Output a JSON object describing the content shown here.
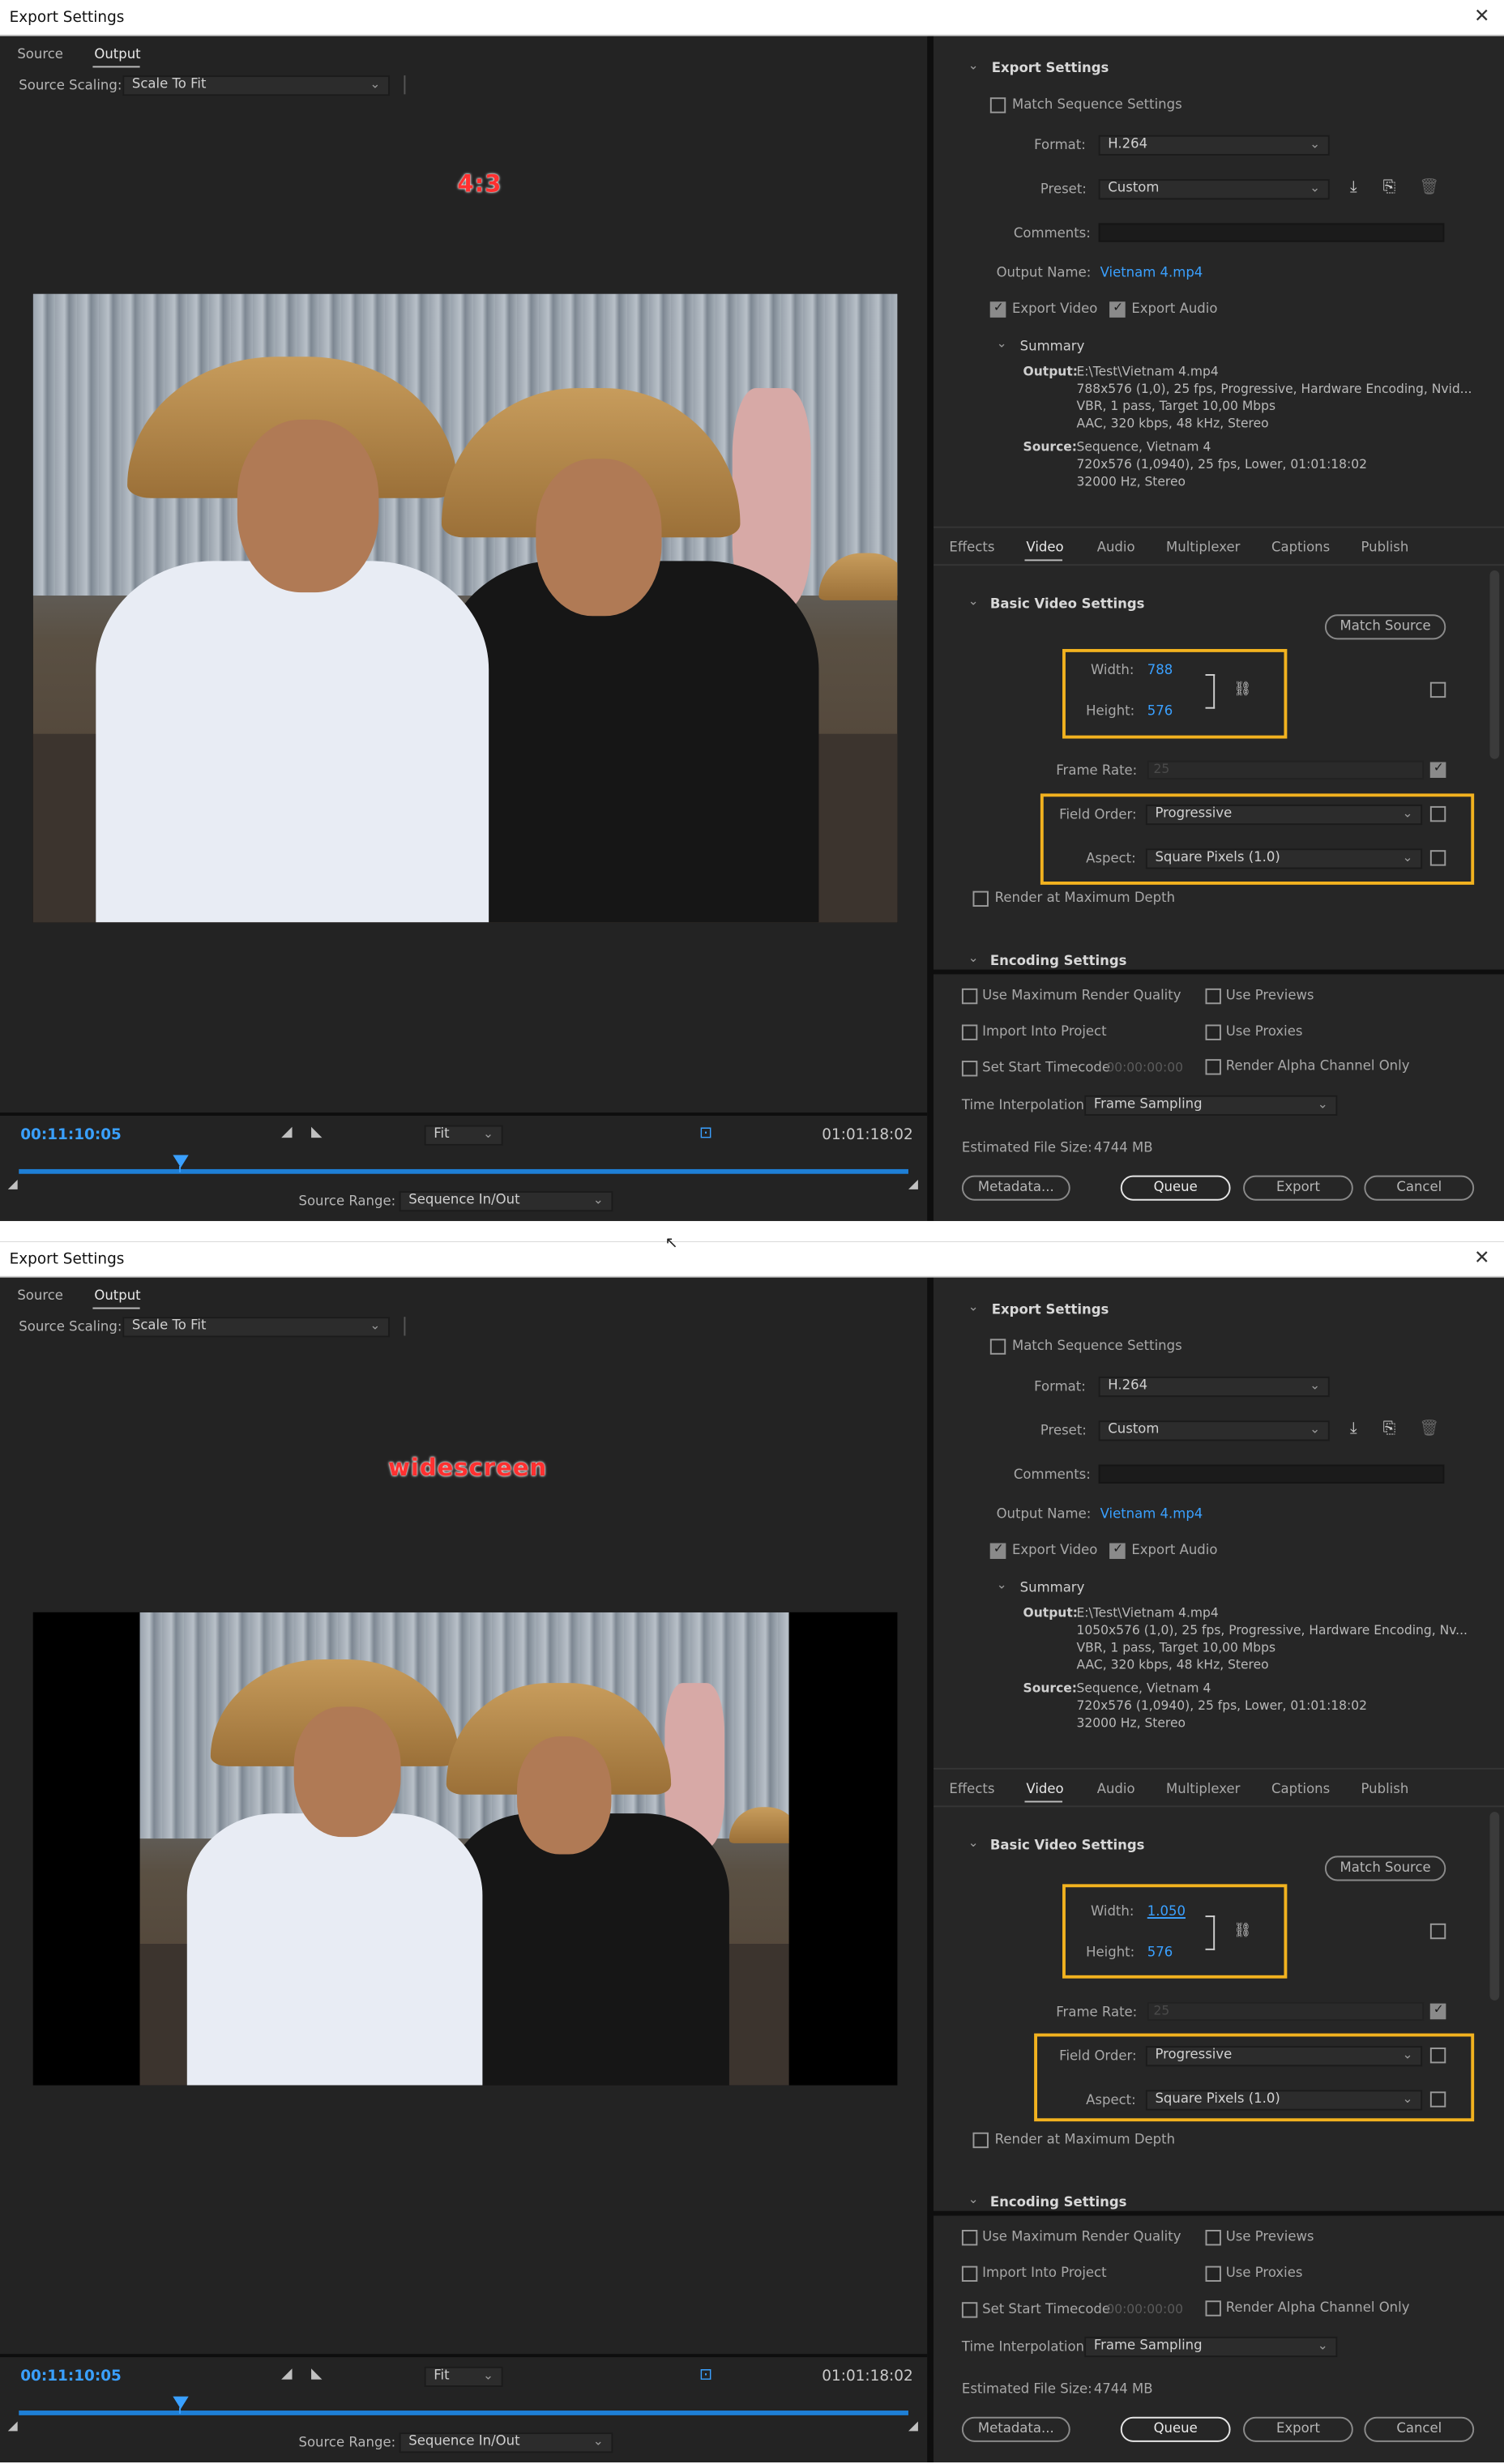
{
  "title": "Export Settings",
  "close_glyph": "✕",
  "top_tabs": {
    "source": "Source",
    "output": "Output"
  },
  "source_scaling": {
    "label": "Source Scaling:",
    "value": "Scale To Fit"
  },
  "timecode_current": "00:11:10:05",
  "timecode_end": "01:01:18:02",
  "fit": "Fit",
  "source_range": {
    "label": "Source Range:",
    "value": "Sequence In/Out"
  },
  "export_settings": {
    "heading": "Export Settings",
    "match_sequence": "Match Sequence Settings",
    "format_label": "Format:",
    "format_value": "H.264",
    "preset_label": "Preset:",
    "preset_value": "Custom",
    "comments_label": "Comments:",
    "output_name_label": "Output Name:",
    "output_name_value": "Vietnam 4.mp4",
    "export_video": "Export Video",
    "export_audio": "Export Audio",
    "summary_heading": "Summary",
    "output_label": "Output:",
    "source_label": "Source:"
  },
  "settings_tabs": [
    "Effects",
    "Video",
    "Audio",
    "Multiplexer",
    "Captions",
    "Publish"
  ],
  "video": {
    "heading": "Basic Video Settings",
    "match_source": "Match Source",
    "width_label": "Width:",
    "height_label": "Height:",
    "frame_rate_label": "Frame Rate:",
    "frame_rate_value": "25",
    "field_order_label": "Field Order:",
    "field_order_value": "Progressive",
    "aspect_label": "Aspect:",
    "aspect_value": "Square Pixels (1.0)",
    "render_max_depth": "Render at Maximum Depth",
    "encoding_heading": "Encoding Settings"
  },
  "bottom": {
    "use_max_quality": "Use Maximum Render Quality",
    "use_previews": "Use Previews",
    "import_project": "Import Into Project",
    "use_proxies": "Use Proxies",
    "set_start_tc": "Set Start Timecode",
    "start_tc_value": "00:00:00:00",
    "render_alpha": "Render Alpha Channel Only",
    "time_interp_label": "Time Interpolation:",
    "time_interp_value": "Frame Sampling",
    "est_size_label": "Estimated File Size:",
    "est_size_value": "4744 MB",
    "metadata": "Metadata...",
    "queue": "Queue",
    "export": "Export",
    "cancel": "Cancel"
  },
  "w1": {
    "preview_label": "4:3",
    "width": "788",
    "height": "576",
    "output_path": "E:\\Test\\Vietnam 4.mp4",
    "output_line2": "788x576 (1,0), 25 fps, Progressive, Hardware Encoding, Nvid...",
    "output_line3": "VBR, 1 pass, Target 10,00 Mbps",
    "output_line4": "AAC, 320 kbps, 48 kHz, Stereo",
    "source_line1": "Sequence, Vietnam 4",
    "source_line2": "720x576 (1,0940), 25 fps, Lower, 01:01:18:02",
    "source_line3": "32000 Hz, Stereo"
  },
  "w2": {
    "preview_label": "widescreen",
    "width": "1.050",
    "height": "576",
    "output_path": "E:\\Test\\Vietnam 4.mp4",
    "output_line2": "1050x576 (1,0), 25 fps, Progressive, Hardware Encoding, Nv...",
    "output_line3": "VBR, 1 pass, Target 10,00 Mbps",
    "output_line4": "AAC, 320 kbps, 48 kHz, Stereo",
    "source_line1": "Sequence, Vietnam 4",
    "source_line2": "720x576 (1,0940), 25 fps, Lower, 01:01:18:02",
    "source_line3": "32000 Hz, Stereo"
  },
  "colors": {
    "accent": "#3aa0ff",
    "highlight": "#f2b21f",
    "label_red": "#ff3030"
  },
  "icons": [
    "close-icon",
    "chevron-down-icon",
    "import-preset-icon",
    "save-preset-icon",
    "delete-preset-icon",
    "unlink-chain-icon",
    "mark-in-icon",
    "mark-out-icon",
    "crop-icon",
    "playhead-icon"
  ]
}
